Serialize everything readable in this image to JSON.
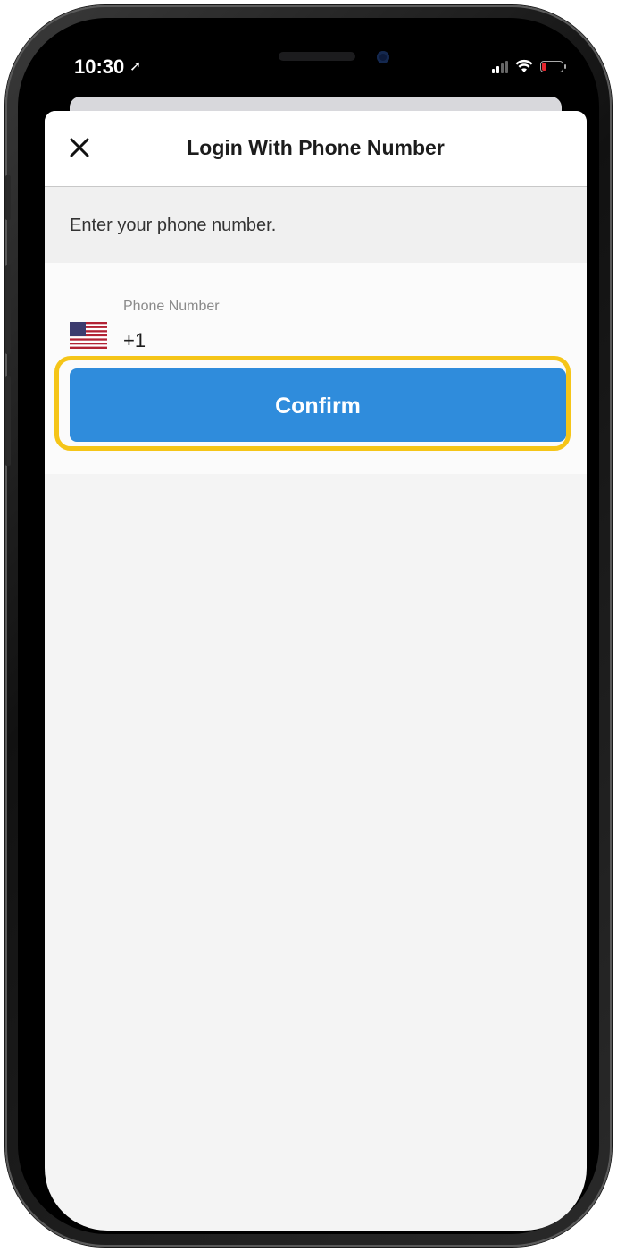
{
  "status_bar": {
    "time": "10:30",
    "location_glyph": "➚",
    "battery_color": "#e3262d"
  },
  "header": {
    "close_icon": "close-icon",
    "title": "Login With Phone Number"
  },
  "prompt": {
    "text": "Enter your phone number."
  },
  "phone_field": {
    "label": "Phone Number",
    "value": "+1",
    "country_flag": "us-flag-icon"
  },
  "confirm": {
    "label": "Confirm",
    "color": "#2f8cdc",
    "highlight_color": "#f5c518"
  }
}
